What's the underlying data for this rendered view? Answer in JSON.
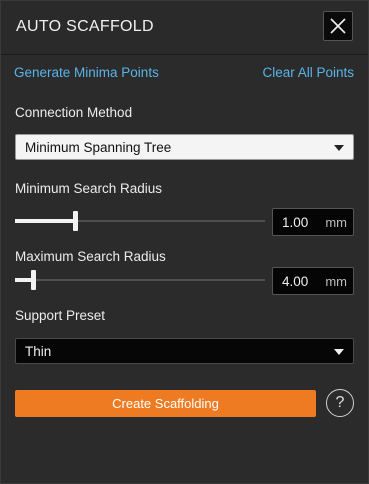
{
  "header": {
    "title": "AUTO SCAFFOLD"
  },
  "links": {
    "generate": "Generate Minima Points",
    "clear": "Clear All Points"
  },
  "connection": {
    "label": "Connection Method",
    "value": "Minimum Spanning Tree"
  },
  "min_radius": {
    "label": "Minimum Search Radius",
    "value": "1.00",
    "unit": "mm",
    "slider_fraction": 0.24
  },
  "max_radius": {
    "label": "Maximum Search Radius",
    "value": "4.00",
    "unit": "mm",
    "slider_fraction": 0.07
  },
  "support": {
    "label": "Support Preset",
    "value": "Thin"
  },
  "actions": {
    "create_label": "Create Scaffolding",
    "help_label": "?"
  },
  "colors": {
    "accent": "#ee7b22",
    "link": "#5ab3e8",
    "background": "#2b2b2b"
  }
}
